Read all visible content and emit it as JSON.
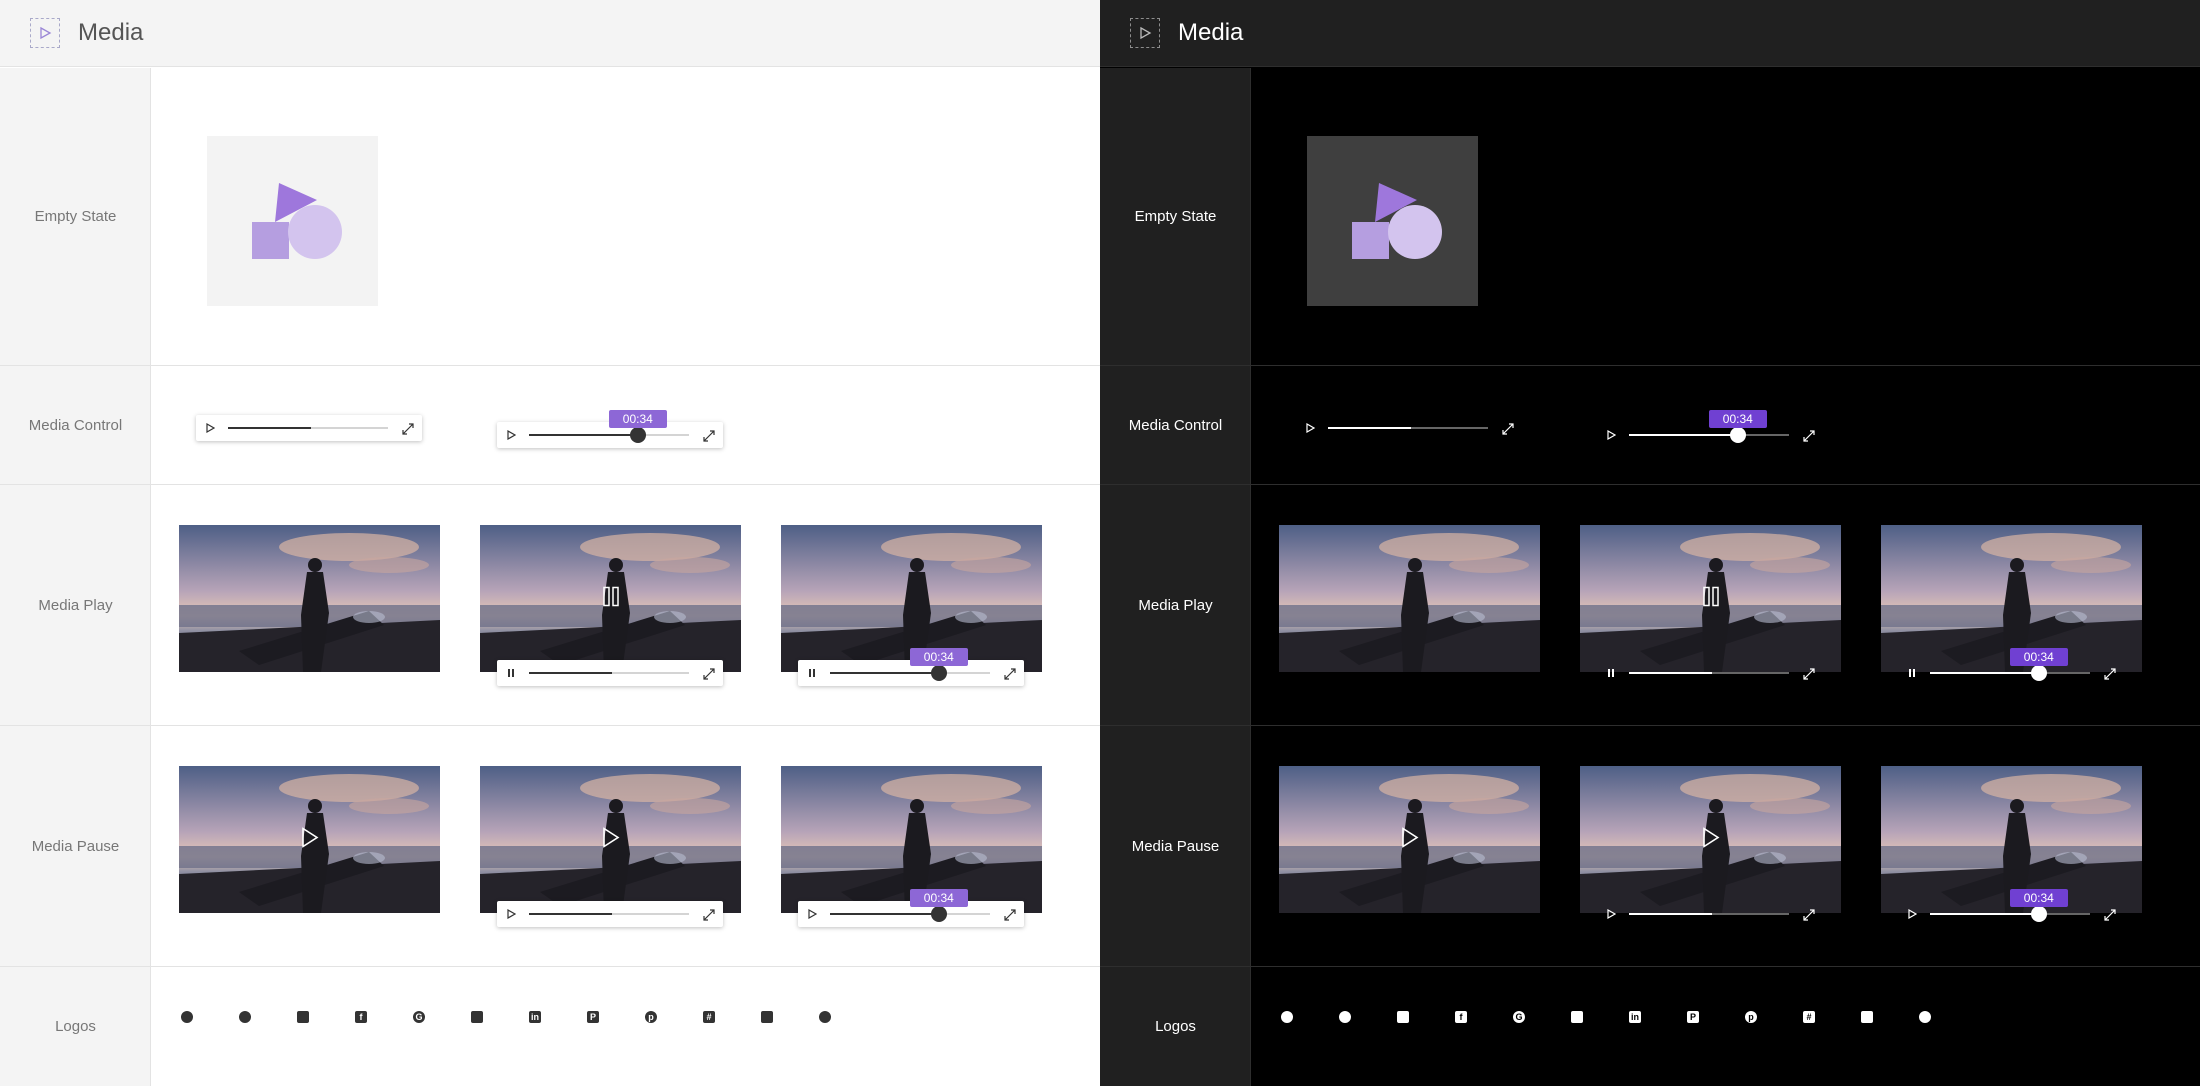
{
  "header": {
    "title": "Media"
  },
  "rows": {
    "empty": "Empty State",
    "control": "Media Control",
    "play": "Media Play",
    "pause": "Media Pause",
    "logos": "Logos"
  },
  "media": {
    "time_label": "00:34",
    "progress_short": 0.52,
    "progress_long": 0.68
  },
  "logos": [
    "apple-icon",
    "dribbble-icon",
    "dropbox-icon",
    "facebook-icon",
    "google-icon",
    "instagram-icon",
    "linkedin-icon",
    "paypal-icon",
    "pinterest-icon",
    "slack-icon",
    "twitter-icon",
    "whatsapp-icon"
  ],
  "colors": {
    "accent": "#8d67d6",
    "accent_dark": "#7040d2",
    "shape_dark": "#b59ee0",
    "shape_light": "#d3c4ee",
    "triangle": "#9e77dc"
  }
}
